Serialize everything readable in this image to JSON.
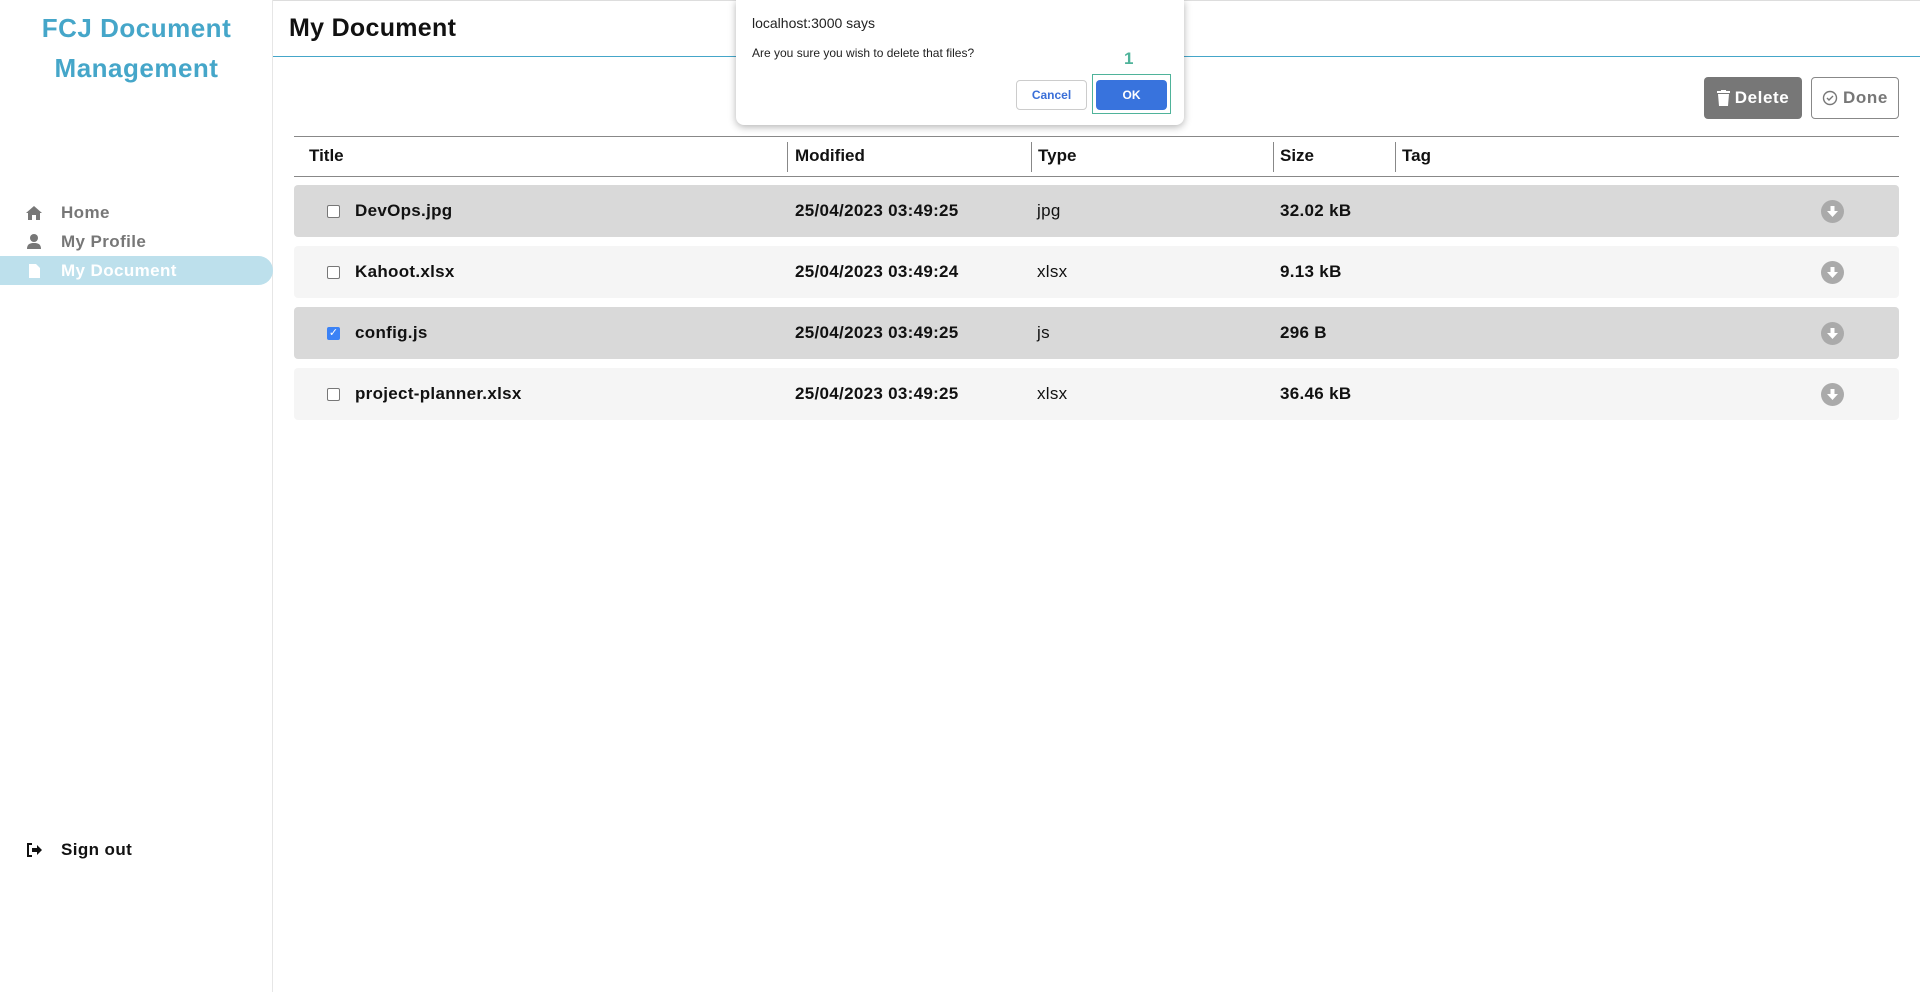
{
  "sidebar": {
    "brand_line1": "FCJ Document",
    "brand_line2": "Management",
    "items": [
      {
        "label": "Home",
        "icon": "home-icon"
      },
      {
        "label": "My Profile",
        "icon": "user-icon"
      },
      {
        "label": "My Document",
        "icon": "file-icon",
        "active": true
      }
    ],
    "sign_out": "Sign out"
  },
  "header": {
    "title": "My Document"
  },
  "toolbar": {
    "delete_label": "Delete",
    "done_label": "Done"
  },
  "table": {
    "columns": [
      "Title",
      "Modified",
      "Type",
      "Size",
      "Tag"
    ],
    "rows": [
      {
        "title": "DevOps.jpg",
        "modified": "25/04/2023 03:49:25",
        "type": "jpg",
        "size": "32.02 kB",
        "tag": "",
        "checked": false
      },
      {
        "title": "Kahoot.xlsx",
        "modified": "25/04/2023 03:49:24",
        "type": "xlsx",
        "size": "9.13 kB",
        "tag": "",
        "checked": false
      },
      {
        "title": "config.js",
        "modified": "25/04/2023 03:49:25",
        "type": "js",
        "size": "296 B",
        "tag": "",
        "checked": true
      },
      {
        "title": "project-planner.xlsx",
        "modified": "25/04/2023 03:49:25",
        "type": "xlsx",
        "size": "36.46 kB",
        "tag": "",
        "checked": false
      }
    ]
  },
  "dialog": {
    "title": "localhost:3000 says",
    "message": "Are you sure you wish to delete that files?",
    "cancel_label": "Cancel",
    "ok_label": "OK",
    "marker": "1"
  },
  "colors": {
    "accent": "#45a6c9",
    "ok": "#3873dd",
    "marker": "#4fb39a"
  }
}
